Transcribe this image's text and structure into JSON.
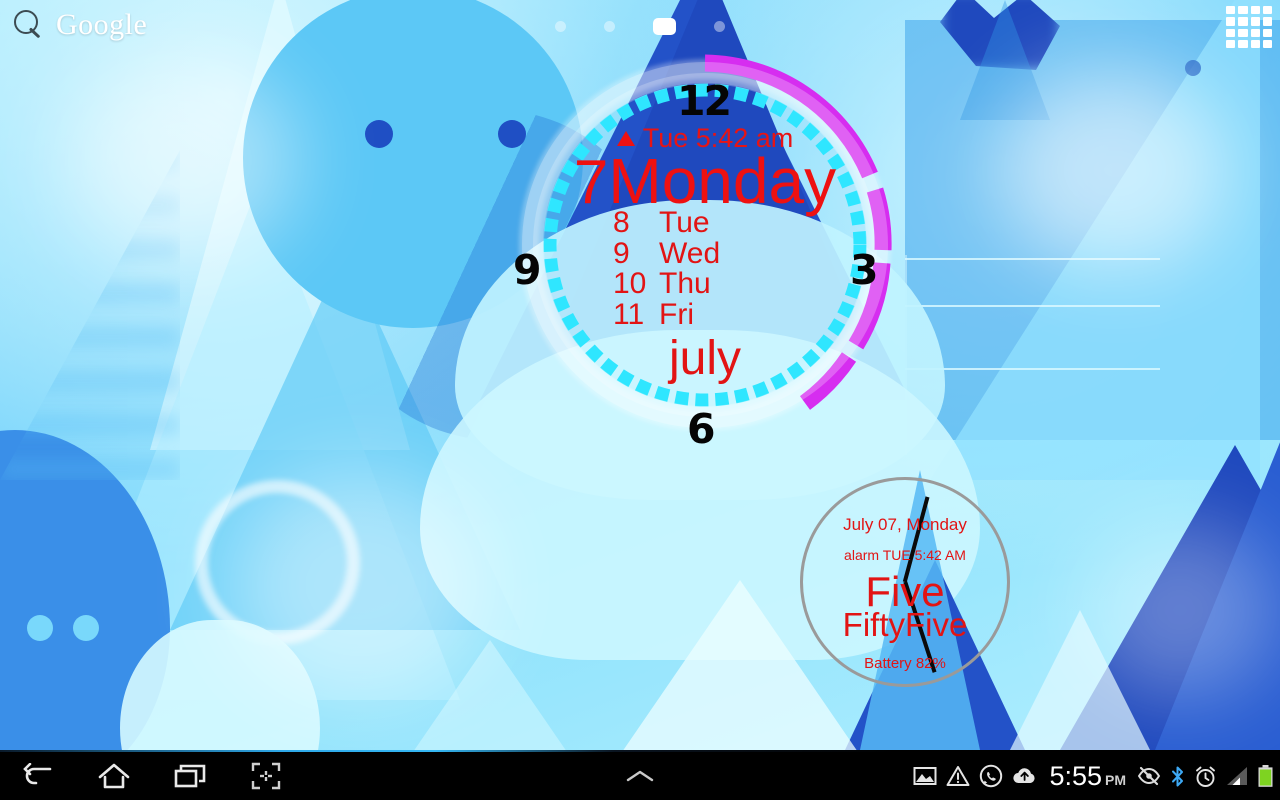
{
  "search_widget": {
    "brand": "Google",
    "icon": "search-icon"
  },
  "page_indicator": {
    "count": 4,
    "active_index": 2
  },
  "app_drawer": {
    "icon": "apps-grid-icon"
  },
  "clock_widget": {
    "alarm_icon": "alarm-bell-icon",
    "alarm_text": "Tue 5:42 am",
    "today_number": "7",
    "today_name": "Monday",
    "upcoming": [
      {
        "num": "8",
        "day": "Tue"
      },
      {
        "num": "9",
        "day": "Wed"
      },
      {
        "num": "10",
        "day": "Thu"
      },
      {
        "num": "11",
        "day": "Fri"
      }
    ],
    "month": "july",
    "numerals": {
      "twelve": "12",
      "three": "3",
      "six": "6",
      "nine": "9"
    },
    "colors": {
      "text": "#ee1111",
      "outer_arc": "#d62df0",
      "inner_arc": "#2fe6ff",
      "numerals": "#050505"
    }
  },
  "clock_widget_2": {
    "date": "July 07, Monday",
    "alarm": "alarm TUE 5:42 AM",
    "hour_word": "Five",
    "minute_word": "FiftyFive",
    "battery": "Battery 82%",
    "colors": {
      "text": "#e21414",
      "dial": "#9a9a9a",
      "hand": "#0a0a0a"
    }
  },
  "system_bar": {
    "nav": [
      {
        "name": "back-button",
        "icon": "back-arrow-icon"
      },
      {
        "name": "home-button",
        "icon": "home-icon"
      },
      {
        "name": "recents-button",
        "icon": "recents-icon"
      },
      {
        "name": "screenshot-button",
        "icon": "screenshot-icon"
      }
    ],
    "center_handle": "chevron-up-icon",
    "status_icons": [
      "screenshot-captured-icon",
      "warning-triangle-icon",
      "whatsapp-icon",
      "cloud-upload-icon"
    ],
    "time": "5:55",
    "ampm": "PM",
    "right_icons": [
      "eye-off-icon",
      "bluetooth-icon",
      "alarm-clock-icon",
      "signal-bars-icon",
      "battery-icon"
    ],
    "colors": {
      "background": "#000000",
      "time_text": "#ffffff",
      "battery": "#7ed321"
    }
  }
}
